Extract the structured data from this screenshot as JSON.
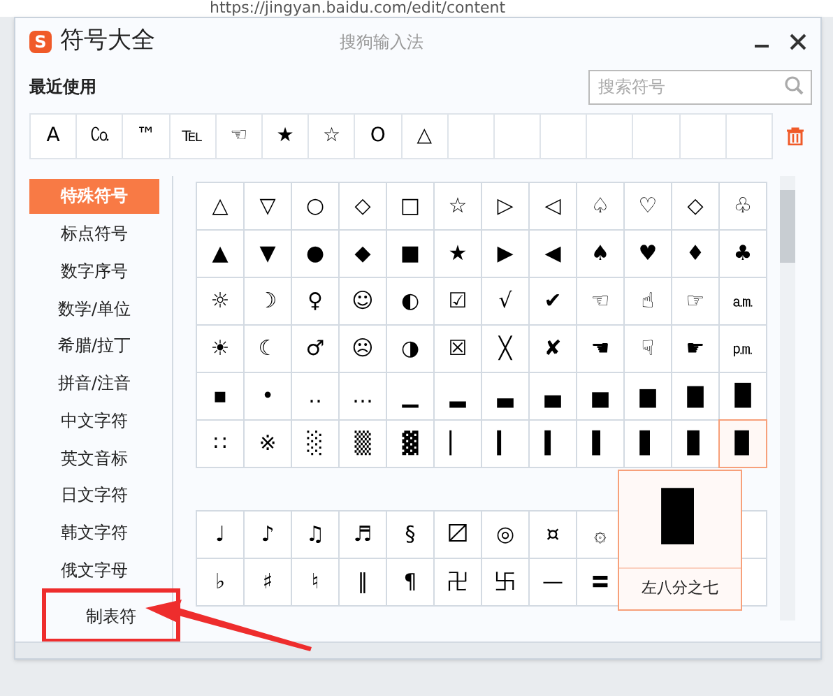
{
  "browser": {
    "url": "https://jingyan.baidu.com/edit/content"
  },
  "window": {
    "title": "符号大全",
    "app_name": "搜狗输入法",
    "logo": "S"
  },
  "recent": {
    "label": "最近使用",
    "symbols": [
      "A",
      "㏇",
      "™",
      "℡",
      "☜",
      "★",
      "☆",
      "O",
      "△"
    ]
  },
  "search": {
    "placeholder": "搜索符号"
  },
  "sidebar": {
    "items": [
      {
        "label": "特殊符号",
        "selected": true,
        "highlighted": false
      },
      {
        "label": "标点符号",
        "selected": false,
        "highlighted": false
      },
      {
        "label": "数字序号",
        "selected": false,
        "highlighted": false
      },
      {
        "label": "数学/单位",
        "selected": false,
        "highlighted": false
      },
      {
        "label": "希腊/拉丁",
        "selected": false,
        "highlighted": false
      },
      {
        "label": "拼音/注音",
        "selected": false,
        "highlighted": false
      },
      {
        "label": "中文字符",
        "selected": false,
        "highlighted": false
      },
      {
        "label": "英文音标",
        "selected": false,
        "highlighted": false
      },
      {
        "label": "日文字符",
        "selected": false,
        "highlighted": false
      },
      {
        "label": "韩文字符",
        "selected": false,
        "highlighted": false
      },
      {
        "label": "俄文字母",
        "selected": false,
        "highlighted": false
      },
      {
        "label": "制表符",
        "selected": false,
        "highlighted": true
      }
    ]
  },
  "grids": [
    {
      "rows": [
        [
          {
            "symbol": "△",
            "hovered": false
          },
          {
            "symbol": "▽",
            "hovered": false
          },
          {
            "symbol": "○",
            "hovered": false
          },
          {
            "symbol": "◇",
            "hovered": false
          },
          {
            "symbol": "□",
            "hovered": false
          },
          {
            "symbol": "☆",
            "hovered": false
          },
          {
            "symbol": "▷",
            "hovered": false
          },
          {
            "symbol": "◁",
            "hovered": false
          },
          {
            "symbol": "♤",
            "hovered": false
          },
          {
            "symbol": "♡",
            "hovered": false
          },
          {
            "symbol": "◇",
            "hovered": false
          },
          {
            "symbol": "♧",
            "hovered": false
          }
        ],
        [
          {
            "symbol": "▲",
            "hovered": false
          },
          {
            "symbol": "▼",
            "hovered": false
          },
          {
            "symbol": "●",
            "hovered": false
          },
          {
            "symbol": "◆",
            "hovered": false
          },
          {
            "symbol": "■",
            "hovered": false
          },
          {
            "symbol": "★",
            "hovered": false
          },
          {
            "symbol": "▶",
            "hovered": false
          },
          {
            "symbol": "◀",
            "hovered": false
          },
          {
            "symbol": "♠",
            "hovered": false
          },
          {
            "symbol": "♥",
            "hovered": false
          },
          {
            "symbol": "♦",
            "hovered": false
          },
          {
            "symbol": "♣",
            "hovered": false
          }
        ],
        [
          {
            "symbol": "☼",
            "hovered": false
          },
          {
            "symbol": "☽",
            "hovered": false
          },
          {
            "symbol": "♀",
            "hovered": false
          },
          {
            "symbol": "☺",
            "hovered": false
          },
          {
            "symbol": "◐",
            "hovered": false
          },
          {
            "symbol": "☑",
            "hovered": false
          },
          {
            "symbol": "√",
            "hovered": false
          },
          {
            "symbol": "✔",
            "hovered": false
          },
          {
            "symbol": "☜",
            "hovered": false
          },
          {
            "symbol": "☝",
            "hovered": false
          },
          {
            "symbol": "☞",
            "hovered": false
          },
          {
            "symbol": "㏂",
            "hovered": false
          }
        ],
        [
          {
            "symbol": "☀",
            "hovered": false
          },
          {
            "symbol": "☾",
            "hovered": false
          },
          {
            "symbol": "♂",
            "hovered": false
          },
          {
            "symbol": "☹",
            "hovered": false
          },
          {
            "symbol": "◑",
            "hovered": false
          },
          {
            "symbol": "☒",
            "hovered": false
          },
          {
            "symbol": "╳",
            "hovered": false
          },
          {
            "symbol": "✘",
            "hovered": false
          },
          {
            "symbol": "☚",
            "hovered": false
          },
          {
            "symbol": "☟",
            "hovered": false
          },
          {
            "symbol": "☛",
            "hovered": false
          },
          {
            "symbol": "㏘",
            "hovered": false
          }
        ],
        [
          {
            "symbol": "▪",
            "hovered": false
          },
          {
            "symbol": "•",
            "hovered": false
          },
          {
            "symbol": "‥",
            "hovered": false
          },
          {
            "symbol": "…",
            "hovered": false
          },
          {
            "symbol": "▁",
            "hovered": false
          },
          {
            "symbol": "▂",
            "hovered": false
          },
          {
            "symbol": "▃",
            "hovered": false
          },
          {
            "symbol": "▄",
            "hovered": false
          },
          {
            "symbol": "▅",
            "hovered": false
          },
          {
            "symbol": "▆",
            "hovered": false
          },
          {
            "symbol": "▇",
            "hovered": false
          },
          {
            "symbol": "█",
            "hovered": false
          }
        ],
        [
          {
            "symbol": "∷",
            "hovered": false
          },
          {
            "symbol": "※",
            "hovered": false
          },
          {
            "symbol": "░",
            "hovered": false
          },
          {
            "symbol": "▒",
            "hovered": false
          },
          {
            "symbol": "▓",
            "hovered": false
          },
          {
            "symbol": "▏",
            "hovered": false
          },
          {
            "symbol": "▎",
            "hovered": false
          },
          {
            "symbol": "▍",
            "hovered": false
          },
          {
            "symbol": "▌",
            "hovered": false
          },
          {
            "symbol": "▋",
            "hovered": false
          },
          {
            "symbol": "▊",
            "hovered": false
          },
          {
            "symbol": "▉",
            "hovered": true
          }
        ]
      ]
    },
    {
      "rows": [
        [
          {
            "symbol": "♩",
            "hovered": false
          },
          {
            "symbol": "♪",
            "hovered": false
          },
          {
            "symbol": "♫",
            "hovered": false
          },
          {
            "symbol": "♬",
            "hovered": false
          },
          {
            "symbol": "§",
            "hovered": false
          },
          {
            "symbol": "〼",
            "hovered": false
          },
          {
            "symbol": "◎",
            "hovered": false
          },
          {
            "symbol": "¤",
            "hovered": false
          },
          {
            "symbol": "۞",
            "hovered": false
          }
        ],
        [
          {
            "symbol": "♭",
            "hovered": false
          },
          {
            "symbol": "♯",
            "hovered": false
          },
          {
            "symbol": "♮",
            "hovered": false
          },
          {
            "symbol": "‖",
            "hovered": false
          },
          {
            "symbol": "¶",
            "hovered": false
          },
          {
            "symbol": "卍",
            "hovered": false
          },
          {
            "symbol": "卐",
            "hovered": false
          },
          {
            "symbol": "—",
            "hovered": false
          },
          {
            "symbol": "〓",
            "hovered": false
          }
        ]
      ]
    }
  ],
  "tooltip": {
    "symbol": "▉",
    "name": "左八分之七"
  }
}
